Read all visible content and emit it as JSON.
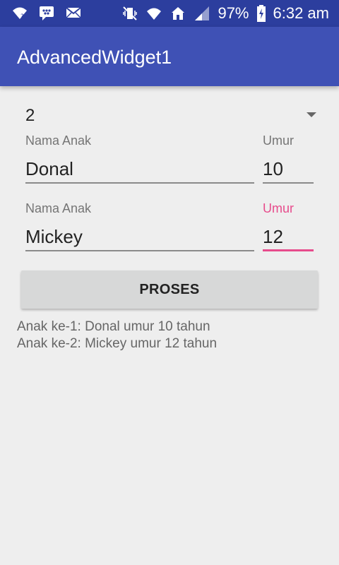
{
  "status_bar": {
    "battery": "97%",
    "time": "6:32 am",
    "icons_left": [
      "wifi-question-icon",
      "bbm-chat-icon",
      "email-icon"
    ],
    "icons_right": [
      "vibrate-mute-icon",
      "wifi-icon",
      "home-icon",
      "signal-icon",
      "battery-charging-icon"
    ]
  },
  "app_bar": {
    "title": "AdvancedWidget1"
  },
  "spinner": {
    "value": "2"
  },
  "children": [
    {
      "name_label": "Nama Anak",
      "name_value": "Donal",
      "age_label": "Umur",
      "age_value": "10"
    },
    {
      "name_label": "Nama Anak",
      "name_value": "Mickey",
      "age_label": "Umur",
      "age_value": "12"
    }
  ],
  "button": {
    "label": "PROSES"
  },
  "results": [
    "Anak ke-1: Donal umur 10 tahun",
    "Anak ke-2: Mickey umur 12 tahun"
  ],
  "colors": {
    "status_bar": "#2c3e9e",
    "app_bar": "#3f51b5",
    "accent": "#e74c8c",
    "background": "#eeeeee"
  }
}
